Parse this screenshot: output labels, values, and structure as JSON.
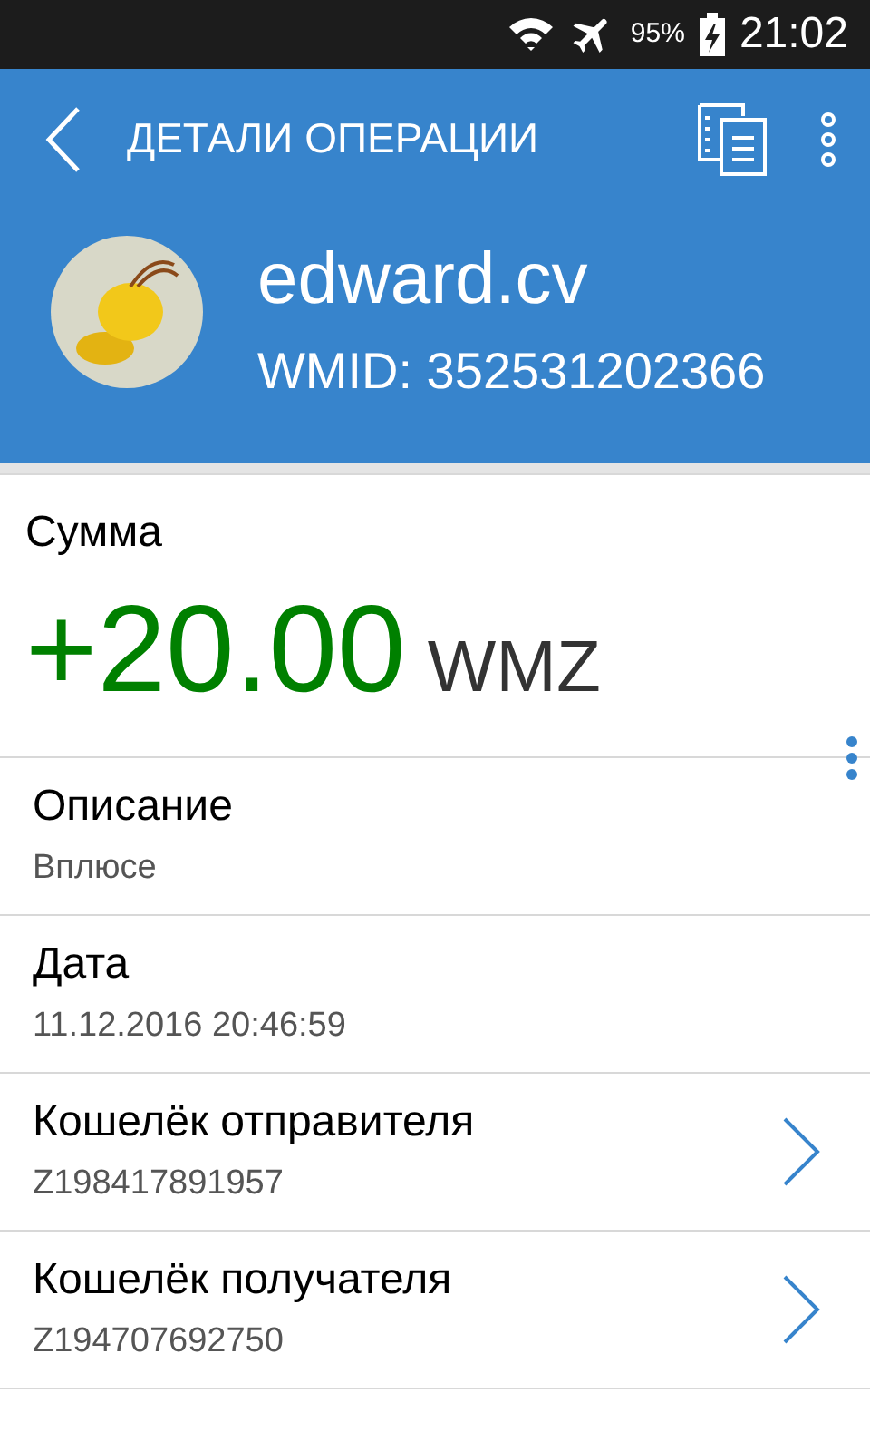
{
  "status_bar": {
    "battery": "95%",
    "time": "21:02"
  },
  "toolbar": {
    "title": "ДЕТАЛИ ОПЕРАЦИИ"
  },
  "profile": {
    "name": "edward.cv",
    "wmid": "WMID: 352531202366"
  },
  "amount": {
    "label": "Сумма",
    "value": "+20.00",
    "currency": "WMZ",
    "color": "#008000"
  },
  "fields": [
    {
      "kind": "plain",
      "label": "Описание",
      "value": "Вплюсе"
    },
    {
      "kind": "plain",
      "label": "Дата",
      "value": "11.12.2016 20:46:59"
    },
    {
      "kind": "link",
      "label": "Кошелёк отправителя",
      "value": "Z198417891957"
    },
    {
      "kind": "link",
      "label": "Кошелёк получателя",
      "value": "Z194707692750"
    }
  ]
}
